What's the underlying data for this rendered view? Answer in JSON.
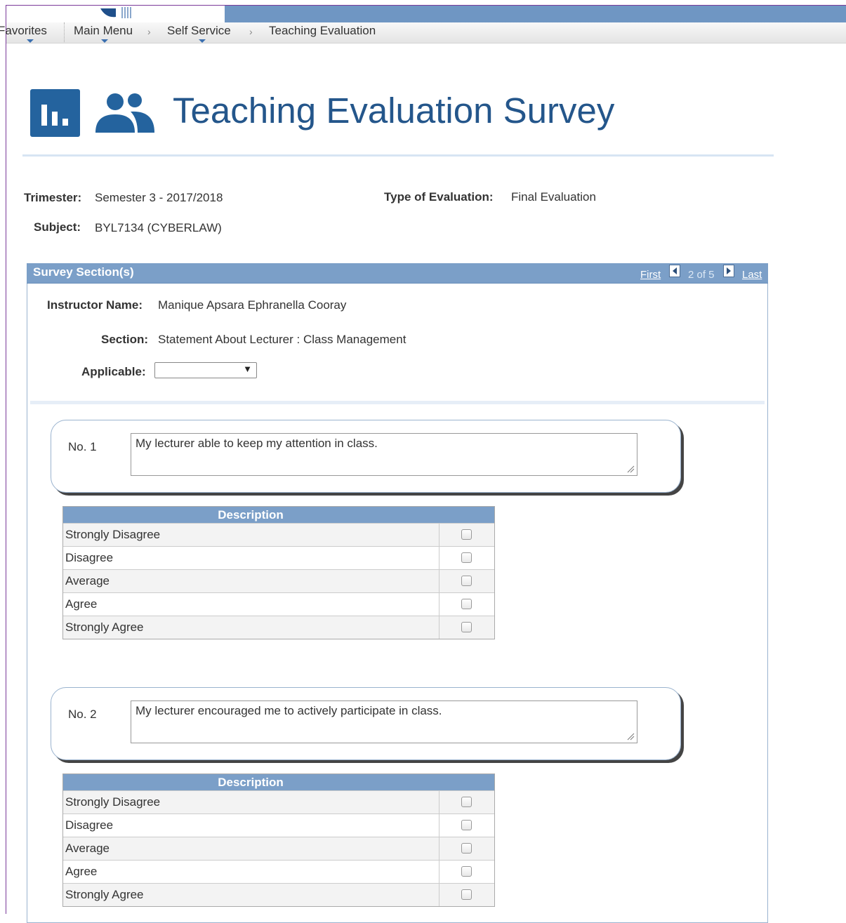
{
  "nav": {
    "favorites": "Favorites",
    "main_menu": "Main Menu",
    "self_service": "Self Service",
    "current": "Teaching Evaluation",
    "separator": "›"
  },
  "header": {
    "title": "Teaching Evaluation Survey"
  },
  "info": {
    "trimester_label": "Trimester:",
    "trimester_value": "Semester 3 - 2017/2018",
    "eval_type_label": "Type of Evaluation:",
    "eval_type_value": "Final Evaluation",
    "subject_label": "Subject:",
    "subject_value": "BYL7134 (CYBERLAW)"
  },
  "panel": {
    "title": "Survey Section(s)",
    "pager": {
      "first": "First",
      "status": "2 of 5",
      "last": "Last"
    },
    "instructor_label": "Instructor Name:",
    "instructor_value": "Manique Apsara Ephranella Cooray",
    "section_label": "Section:",
    "section_value": "Statement About Lecturer : Class Management",
    "applicable_label": "Applicable:",
    "applicable_value": ""
  },
  "questions": [
    {
      "no": "No. 1",
      "text": "My lecturer able to keep my attention in class.",
      "grid_header": "Description",
      "options": [
        "Strongly Disagree",
        "Disagree",
        "Average",
        "Agree",
        "Strongly Agree"
      ]
    },
    {
      "no": "No. 2",
      "text": "My lecturer encouraged me to actively participate in class.",
      "grid_header": "Description",
      "options": [
        "Strongly Disagree",
        "Disagree",
        "Average",
        "Agree",
        "Strongly Agree"
      ]
    }
  ],
  "colors": {
    "banner": "#6f96c3",
    "title": "#24568b",
    "icon": "#24639e",
    "panel_header": "#7b9fc8"
  }
}
